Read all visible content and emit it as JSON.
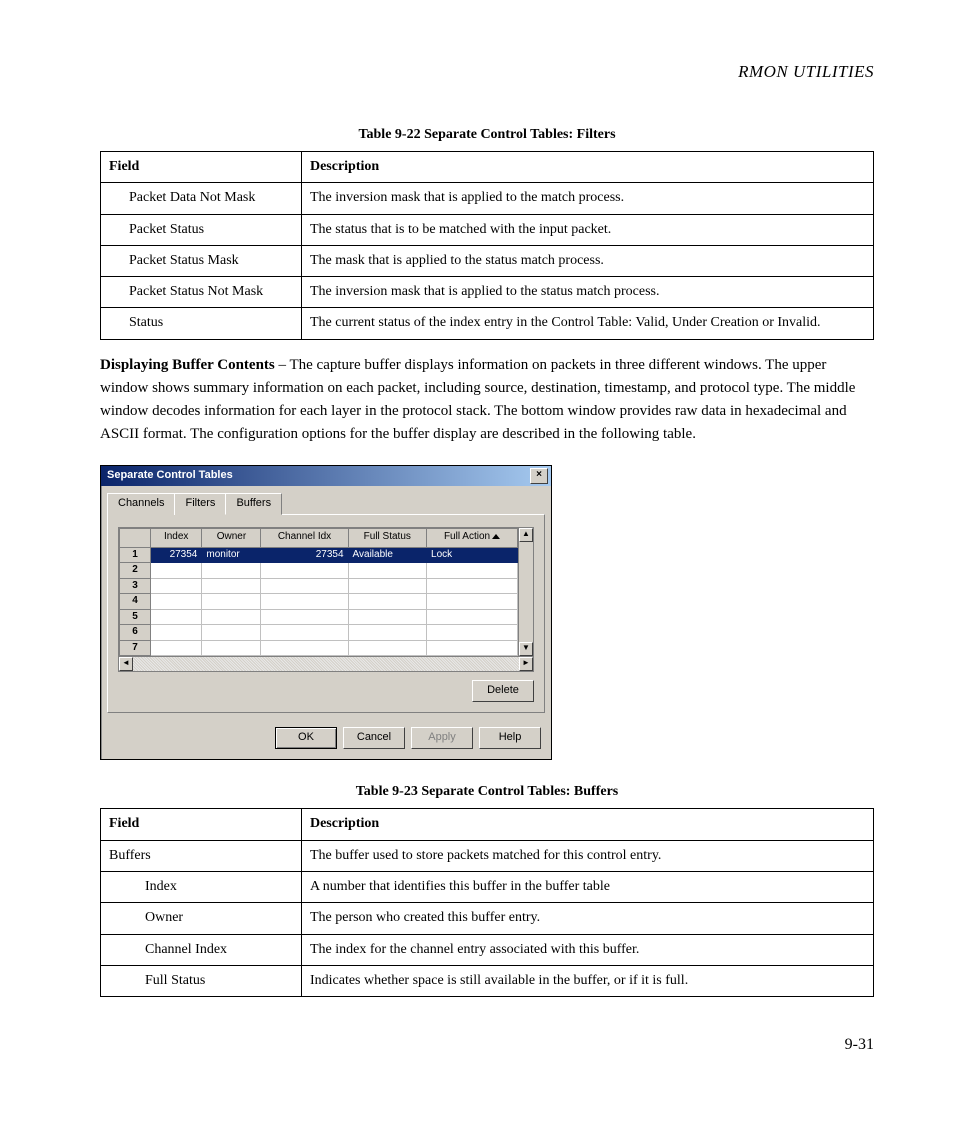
{
  "page_header": "RMON UTILITIES",
  "table22": {
    "caption": "Table 9-22  Separate Control Tables: Filters",
    "head_field": "Field",
    "head_desc": "Description",
    "rows": [
      {
        "field": "Packet Data Not Mask",
        "desc": "The inversion mask that is applied to the match process.",
        "indent": 1
      },
      {
        "field": "Packet Status",
        "desc": "The status that is to be matched with the input packet.",
        "indent": 1
      },
      {
        "field": "Packet Status Mask",
        "desc": "The mask that is applied to the status match process.",
        "indent": 1
      },
      {
        "field": "Packet Status Not Mask",
        "desc": "The inversion mask that is applied to the status match process.",
        "indent": 1
      },
      {
        "field": "Status",
        "desc": "The current status of the index entry in the Control Table: Valid, Under Creation or Invalid.",
        "indent": 1
      }
    ]
  },
  "paragraph": {
    "lead": "Displaying Buffer Contents",
    "rest": " – The capture buffer displays information on packets in three different windows. The upper window shows summary information on each packet, including source, destination, timestamp, and protocol type. The middle window decodes information for each layer in the protocol stack. The bottom window provides raw data in hexadecimal and ASCII format. The configuration options for the buffer display are described in the following table."
  },
  "dialog": {
    "title": "Separate Control Tables",
    "tabs": {
      "channels": "Channels",
      "filters": "Filters",
      "buffers": "Buffers"
    },
    "grid": {
      "headers": {
        "index": "Index",
        "owner": "Owner",
        "channel_idx": "Channel Idx",
        "full_status": "Full Status",
        "full_action": "Full Action"
      },
      "row_labels": [
        "1",
        "2",
        "3",
        "4",
        "5",
        "6",
        "7"
      ],
      "rows": [
        {
          "index": "27354",
          "owner": "monitor",
          "channel_idx": "27354",
          "full_status": "Available",
          "full_action": "Lock"
        }
      ]
    },
    "buttons": {
      "delete": "Delete",
      "ok": "OK",
      "cancel": "Cancel",
      "apply": "Apply",
      "help": "Help"
    }
  },
  "table23": {
    "caption": "Table 9-23  Separate Control Tables: Buffers",
    "head_field": "Field",
    "head_desc": "Description",
    "rows": [
      {
        "field": "Buffers",
        "desc": "The buffer used to store packets matched for this control entry.",
        "indent": 0
      },
      {
        "field": "Index",
        "desc": "A number that identifies this buffer in the buffer table",
        "indent": 2
      },
      {
        "field": "Owner",
        "desc": "The person who created this buffer entry.",
        "indent": 2
      },
      {
        "field": "Channel Index",
        "desc": "The index for the channel entry associated with this buffer.",
        "indent": 2
      },
      {
        "field": "Full Status",
        "desc": "Indicates whether space is still available in the buffer, or if it is full.",
        "indent": 2
      }
    ]
  },
  "page_number": "9-31"
}
